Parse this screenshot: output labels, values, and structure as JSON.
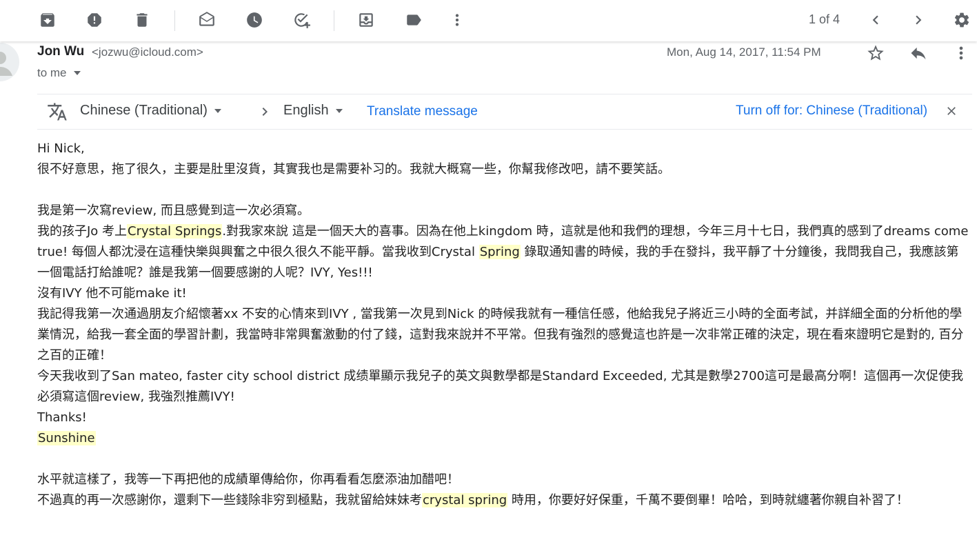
{
  "toolbar": {
    "pager": "1 of 4",
    "icons": [
      "archive-icon",
      "report-spam-icon",
      "delete-icon",
      "mark-unread-icon",
      "snooze-icon",
      "add-to-tasks-icon",
      "move-to-icon",
      "label-icon",
      "more-vert-icon",
      "chevron-left-icon",
      "chevron-right-icon",
      "settings-icon"
    ]
  },
  "header": {
    "sender_name": "Jon Wu",
    "sender_email": "<jozwu@icloud.com>",
    "to": "to me",
    "date": "Mon, Aug 14, 2017, 11:54 PM"
  },
  "translate": {
    "source_lang": "Chinese (Traditional)",
    "target_lang": "English",
    "translate_link": "Translate message",
    "turn_off": "Turn off for: Chinese (Traditional)"
  },
  "body": {
    "l1": "Hi Nick,",
    "l2": "很不好意思，拖了很久，主要是肚里沒貨，其實我也是需要补习的。我就大概寫一些，你幫我修改吧，請不要笑話。",
    "l3": "我是第一次寫review, 而且感覺到這一次必須寫。",
    "l4a": "我的孩子Jo 考上",
    "l4_mark": "Crystal Springs",
    "l4b": ".對我家來說 這是一個天大的喜事。因為在他上kingdom 時，這就是他和我們的理想，今年三月十七日，我們真的感到了dreams come true! 每個人都沈浸在這種快樂與興奮之中很久很久不能平靜。當我收到Crystal ",
    "l4_mark2": "Spring",
    "l4c": " 錄取通知書的時候，我的手在發抖，我平靜了十分鐘後，我問我自己，我應該第一個電話打給誰呢？誰是我第一個要感謝的人呢？IVY, Yes!!!",
    "l5": "沒有IVY 他不可能make it!",
    "l6": "我記得我第一次通過朋友介紹懷著xx 不安的心情來到IVY , 當我第一次見到Nick 的時候我就有一種信任感，他給我兒子將近三小時的全面考試，并詳細全面的分析他的學業情況，給我一套全面的學習計劃，我當時非常興奮激動的付了錢，這對我來說并不平常。但我有強烈的感覺這也許是一次非常正確的決定，現在看來證明它是對的, 百分之百的正確！",
    "l7": "今天我收到了San mateo, faster city school district 成绩單顯示我兒子的英文與數學都是Standard Exceeded, 尤其是數學2700這可是最高分啊！這個再一次促使我必須寫這個review, 我強烈推薦IVY!",
    "l8": "Thanks!",
    "l9": "Sunshine",
    "l10": "水平就這樣了，我等一下再把他的成績單傳給你，你再看看怎麼添油加醋吧！",
    "l11a": "不過真的再一次感謝你，還剩下一些錢除非穷到極點，我就留給妹妹考",
    "l11_mark": "crystal spring",
    "l11b": " 時用，你要好好保重，千萬不要倒畢！哈哈，到時就纏著你親自补習了！"
  }
}
